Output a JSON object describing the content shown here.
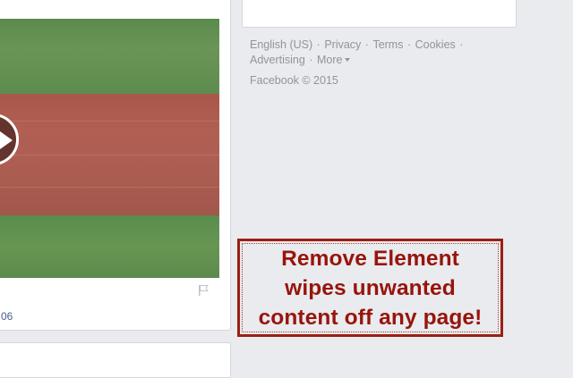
{
  "post": {
    "timestamp_fragment": "06",
    "icons": {
      "play": "play-icon",
      "flag": "flag-icon"
    }
  },
  "footer": {
    "links": [
      {
        "label": "English (US)"
      },
      {
        "label": "Privacy"
      },
      {
        "label": "Terms"
      },
      {
        "label": "Cookies"
      },
      {
        "label": "Advertising"
      },
      {
        "label": "More"
      }
    ],
    "separator": "·",
    "copyright": "Facebook © 2015"
  },
  "promo": {
    "line1": "Remove Element",
    "line2": "wipes unwanted",
    "line3": "content off any page!",
    "color": "#98140c"
  },
  "colors": {
    "page_background": "#e9ebee",
    "card_background": "#ffffff",
    "link_grey": "#90949c",
    "link_blue": "#4b5f8c"
  }
}
